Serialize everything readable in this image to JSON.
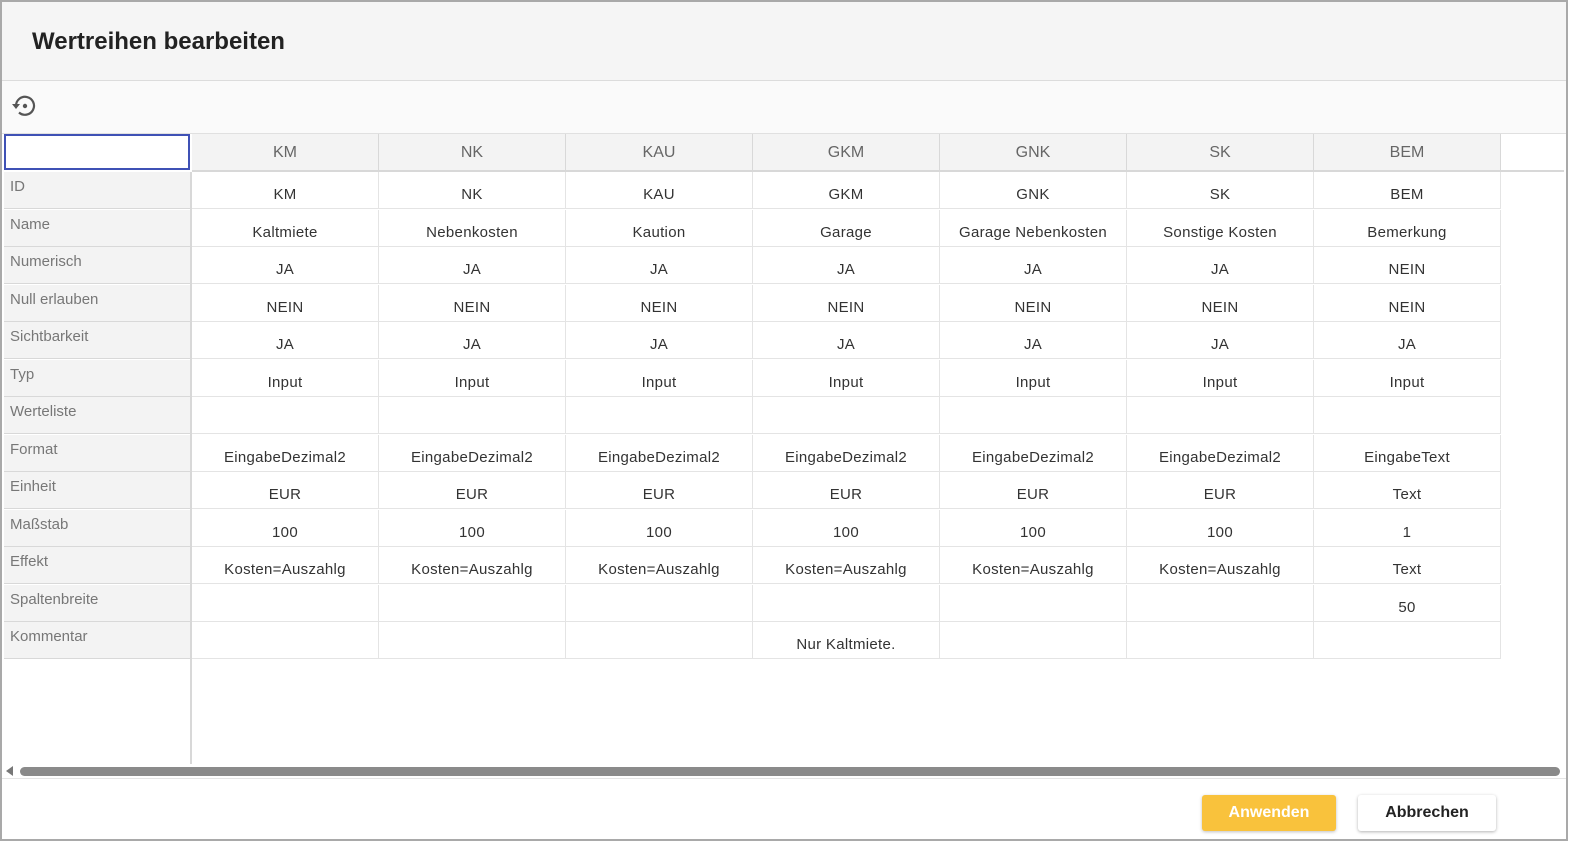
{
  "dialog": {
    "title": "Wertreihen bearbeiten",
    "reset_icon": "history-reset-icon"
  },
  "table": {
    "columns": [
      "KM",
      "NK",
      "KAU",
      "GKM",
      "GNK",
      "SK",
      "BEM"
    ],
    "rows": [
      {
        "label": "ID",
        "values": [
          "KM",
          "NK",
          "KAU",
          "GKM",
          "GNK",
          "SK",
          "BEM"
        ]
      },
      {
        "label": "Name",
        "values": [
          "Kaltmiete",
          "Nebenkosten",
          "Kaution",
          "Garage",
          "Garage Nebenkosten",
          "Sonstige Kosten",
          "Bemerkung"
        ]
      },
      {
        "label": "Numerisch",
        "values": [
          "JA",
          "JA",
          "JA",
          "JA",
          "JA",
          "JA",
          "NEIN"
        ]
      },
      {
        "label": "Null erlauben",
        "values": [
          "NEIN",
          "NEIN",
          "NEIN",
          "NEIN",
          "NEIN",
          "NEIN",
          "NEIN"
        ]
      },
      {
        "label": "Sichtbarkeit",
        "values": [
          "JA",
          "JA",
          "JA",
          "JA",
          "JA",
          "JA",
          "JA"
        ]
      },
      {
        "label": "Typ",
        "values": [
          "Input",
          "Input",
          "Input",
          "Input",
          "Input",
          "Input",
          "Input"
        ]
      },
      {
        "label": "Werteliste",
        "values": [
          "",
          "",
          "",
          "",
          "",
          "",
          ""
        ]
      },
      {
        "label": "Format",
        "values": [
          "EingabeDezimal2",
          "EingabeDezimal2",
          "EingabeDezimal2",
          "EingabeDezimal2",
          "EingabeDezimal2",
          "EingabeDezimal2",
          "EingabeText"
        ]
      },
      {
        "label": "Einheit",
        "values": [
          "EUR",
          "EUR",
          "EUR",
          "EUR",
          "EUR",
          "EUR",
          "Text"
        ]
      },
      {
        "label": "Maßstab",
        "values": [
          "100",
          "100",
          "100",
          "100",
          "100",
          "100",
          "1"
        ]
      },
      {
        "label": "Effekt",
        "values": [
          "Kosten=Auszahlg",
          "Kosten=Auszahlg",
          "Kosten=Auszahlg",
          "Kosten=Auszahlg",
          "Kosten=Auszahlg",
          "Kosten=Auszahlg",
          "Text"
        ]
      },
      {
        "label": "Spaltenbreite",
        "values": [
          "",
          "",
          "",
          "",
          "",
          "",
          "50"
        ]
      },
      {
        "label": "Kommentar",
        "values": [
          "",
          "",
          "",
          "Nur Kaltmiete.",
          "",
          "",
          ""
        ]
      }
    ]
  },
  "footer": {
    "apply_label": "Anwenden",
    "cancel_label": "Abbrechen",
    "apply_color": "#f9c23c"
  }
}
